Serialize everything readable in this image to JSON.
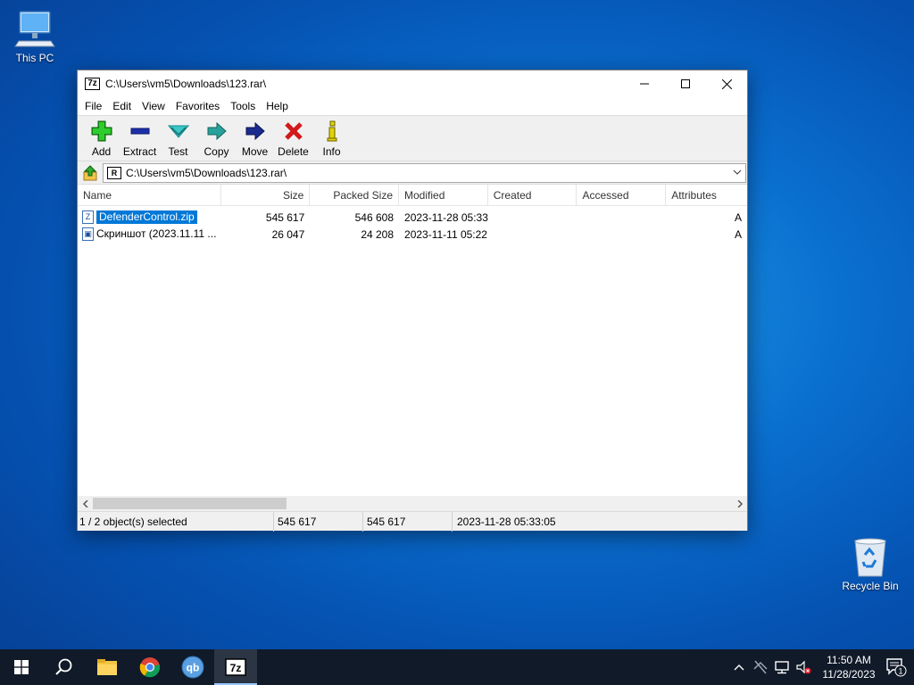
{
  "desktop": {
    "this_pc_label": "This PC",
    "recycle_bin_label": "Recycle Bin"
  },
  "window": {
    "app_badge": "7z",
    "title": "C:\\Users\\vm5\\Downloads\\123.rar\\",
    "menu": [
      "File",
      "Edit",
      "View",
      "Favorites",
      "Tools",
      "Help"
    ],
    "toolbar": [
      {
        "label": "Add",
        "icon": "plus-icon"
      },
      {
        "label": "Extract",
        "icon": "minus-icon"
      },
      {
        "label": "Test",
        "icon": "check-icon"
      },
      {
        "label": "Copy",
        "icon": "arrow-right-icon"
      },
      {
        "label": "Move",
        "icon": "arrow-right-icon"
      },
      {
        "label": "Delete",
        "icon": "x-icon"
      },
      {
        "label": "Info",
        "icon": "info-icon"
      }
    ],
    "address": {
      "path_icon": "R",
      "path": "C:\\Users\\vm5\\Downloads\\123.rar\\"
    },
    "columns": [
      "Name",
      "Size",
      "Packed Size",
      "Modified",
      "Created",
      "Accessed",
      "Attributes"
    ],
    "rows": [
      {
        "icon": "Z",
        "name": "DefenderControl.zip",
        "size": "545 617",
        "packed": "546 608",
        "modified": "2023-11-28 05:33",
        "created": "",
        "accessed": "",
        "attr": "A",
        "selected": true
      },
      {
        "icon": "▣",
        "name": "Скриншот (2023.11.11 ...",
        "size": "26 047",
        "packed": "24 208",
        "modified": "2023-11-11 05:22",
        "created": "",
        "accessed": "",
        "attr": "A",
        "selected": false
      }
    ],
    "status": {
      "selected": "1 / 2 object(s) selected",
      "size": "545 617",
      "packed": "545 617",
      "modified": "2023-11-28 05:33:05"
    }
  },
  "taskbar": {
    "apps": [
      {
        "name": "start-button",
        "icon": "windows-logo-icon"
      },
      {
        "name": "search-button",
        "icon": "search-icon"
      },
      {
        "name": "file-explorer",
        "icon": "folder-icon"
      },
      {
        "name": "chrome",
        "icon": "chrome-icon"
      },
      {
        "name": "qbittorrent",
        "icon": "qbittorrent-icon",
        "text": "qb"
      },
      {
        "name": "7zip",
        "icon": "7zip-icon",
        "text": "7z",
        "active": true
      }
    ],
    "clock": {
      "time": "11:50 AM",
      "date": "11/28/2023"
    },
    "notification_count": "1"
  },
  "colors": {
    "selection": "#0078d7",
    "taskbar": "#101a28",
    "desktop": "#0a6fcf"
  }
}
